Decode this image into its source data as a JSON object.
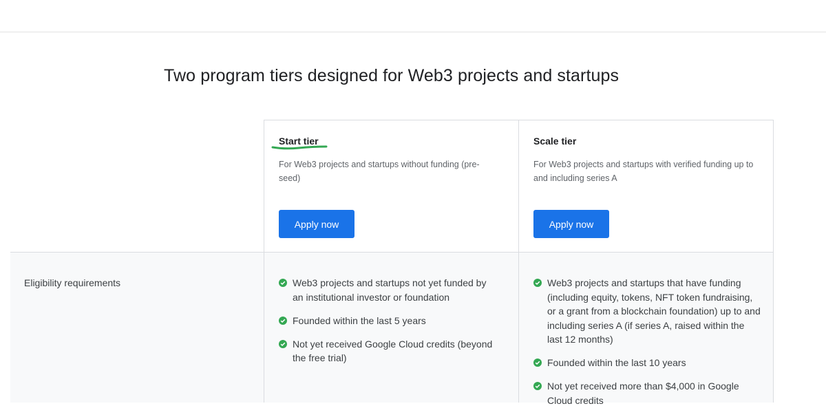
{
  "page": {
    "title": "Two program tiers designed for Web3 projects and startups"
  },
  "tiers": [
    {
      "name": "Start tier",
      "description": "For Web3 projects and startups without funding (pre-seed)",
      "button_label": "Apply now",
      "requirements": [
        "Web3 projects and startups not yet funded by an institutional investor or foundation",
        "Founded within the last 5 years",
        "Not yet received Google Cloud credits (beyond the free trial)"
      ]
    },
    {
      "name": "Scale tier",
      "description": "For Web3 projects and startups with verified funding up to and including series A",
      "button_label": "Apply now",
      "requirements": [
        "Web3 projects and startups that have funding (including equity, tokens, NFT token fundraising, or a grant from a blockchain foundation) up to and including series A (if series A, raised within the last 12 months)",
        "Founded within the last 10 years",
        "Not yet received more than $4,000 in Google Cloud credits"
      ]
    }
  ],
  "rows": {
    "eligibility_label": "Eligibility requirements"
  },
  "colors": {
    "button": "#1a73e8",
    "check": "#34a853",
    "highlight_underline": "#34a853",
    "border": "#dadce0",
    "band": "#f8f9fa"
  },
  "icons": {
    "requirement_bullet": "check-circle-icon"
  }
}
